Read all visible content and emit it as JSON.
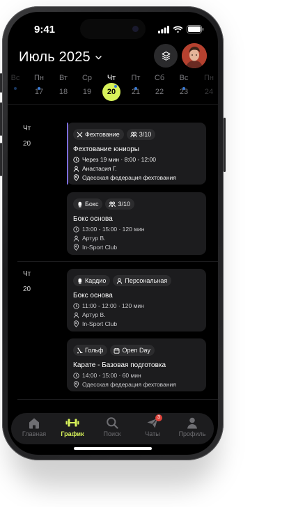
{
  "status": {
    "time": "9:41"
  },
  "header": {
    "month": "Июль 2025"
  },
  "week": [
    {
      "name": "Вс",
      "num": "",
      "dot": true,
      "cut": true
    },
    {
      "name": "Пн",
      "num": "17",
      "dot": true
    },
    {
      "name": "Вт",
      "num": "18",
      "dot": false
    },
    {
      "name": "Ср",
      "num": "19",
      "dot": false
    },
    {
      "name": "Чт",
      "num": "20",
      "dot": true,
      "active": true
    },
    {
      "name": "Пт",
      "num": "21",
      "dot": true
    },
    {
      "name": "Сб",
      "num": "22",
      "dot": false
    },
    {
      "name": "Вс",
      "num": "23",
      "dot": true
    },
    {
      "name": "Пн",
      "num": "24",
      "dot": false,
      "cut": true
    }
  ],
  "groups": [
    {
      "weekday": "Чт",
      "day": "20"
    },
    {
      "weekday": "Чт",
      "day": "20"
    }
  ],
  "events": [
    {
      "chip1": "Фехтование",
      "chip2": "3/10",
      "title": "Фехтование юниоры",
      "time": "Через 19 мин · 8:00 - 12:00",
      "trainer": "Анастасия Г.",
      "place": "Одесская федерация фехтования"
    },
    {
      "chip1": "Бокс",
      "chip2": "3/10",
      "title": "Бокс основа",
      "time": "13:00 - 15:00 · 120 мин",
      "trainer": "Артур В.",
      "place": "In-Sport Club"
    },
    {
      "chip1": "Кардио",
      "chip2": "Персональная",
      "title": "Бокс основа",
      "time": "11:00 - 12:00 · 120 мин",
      "trainer": "Артур В.",
      "place": "In-Sport Club"
    },
    {
      "chip1": "Гольф",
      "chip2": "Open Day",
      "title": "Карате - Базовая подготовка",
      "time": "14:00 - 15:00 · 60 мин",
      "place": "Одесская федерация фехтования"
    }
  ],
  "tabs": [
    {
      "label": "Главная"
    },
    {
      "label": "График"
    },
    {
      "label": "Поиск"
    },
    {
      "label": "Чаты",
      "badge": "3"
    },
    {
      "label": "Профиль"
    }
  ],
  "colors": {
    "accent": "#d7f25a",
    "dot": "#3a7bd5",
    "card": "#1c1c1e",
    "badge": "#e0443c",
    "bar": "#7b6cd9"
  }
}
